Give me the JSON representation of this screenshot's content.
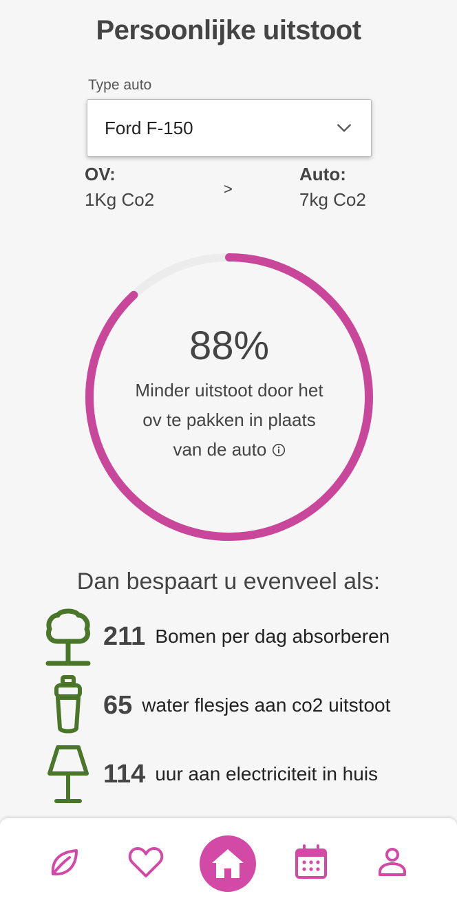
{
  "page": {
    "title": "Persoonlijke uitstoot"
  },
  "car_select": {
    "label": "Type auto",
    "value": "Ford F-150"
  },
  "comparison": {
    "ov_title": "OV:",
    "ov_value": "1Kg Co2",
    "operator": ">",
    "car_title": "Auto:",
    "car_value": "7kg Co2"
  },
  "reduction": {
    "percent_label": "88%",
    "percent_value": 88,
    "description": "Minder uitstoot door het ov te pakken in plaats van de auto"
  },
  "savings": {
    "title": "Dan bespaart u evenveel als:",
    "items": [
      {
        "icon": "tree-icon",
        "number": "211",
        "text": "Bomen per dag absorberen"
      },
      {
        "icon": "water-bottle-icon",
        "number": "65",
        "text": "water flesjes aan co2 uitstoot"
      },
      {
        "icon": "lamp-icon",
        "number": "114",
        "text": "uur aan electriciteit in huis"
      }
    ]
  },
  "nav": {
    "items": [
      "leaf-icon",
      "heart-icon",
      "home-icon",
      "calendar-icon",
      "user-icon"
    ],
    "active": "home-icon"
  },
  "colors": {
    "accent": "#d349a6",
    "ring": "#c9479a",
    "ring_track": "#ececec",
    "icon_green": "#4a7629",
    "background": "#f6f6f6"
  }
}
